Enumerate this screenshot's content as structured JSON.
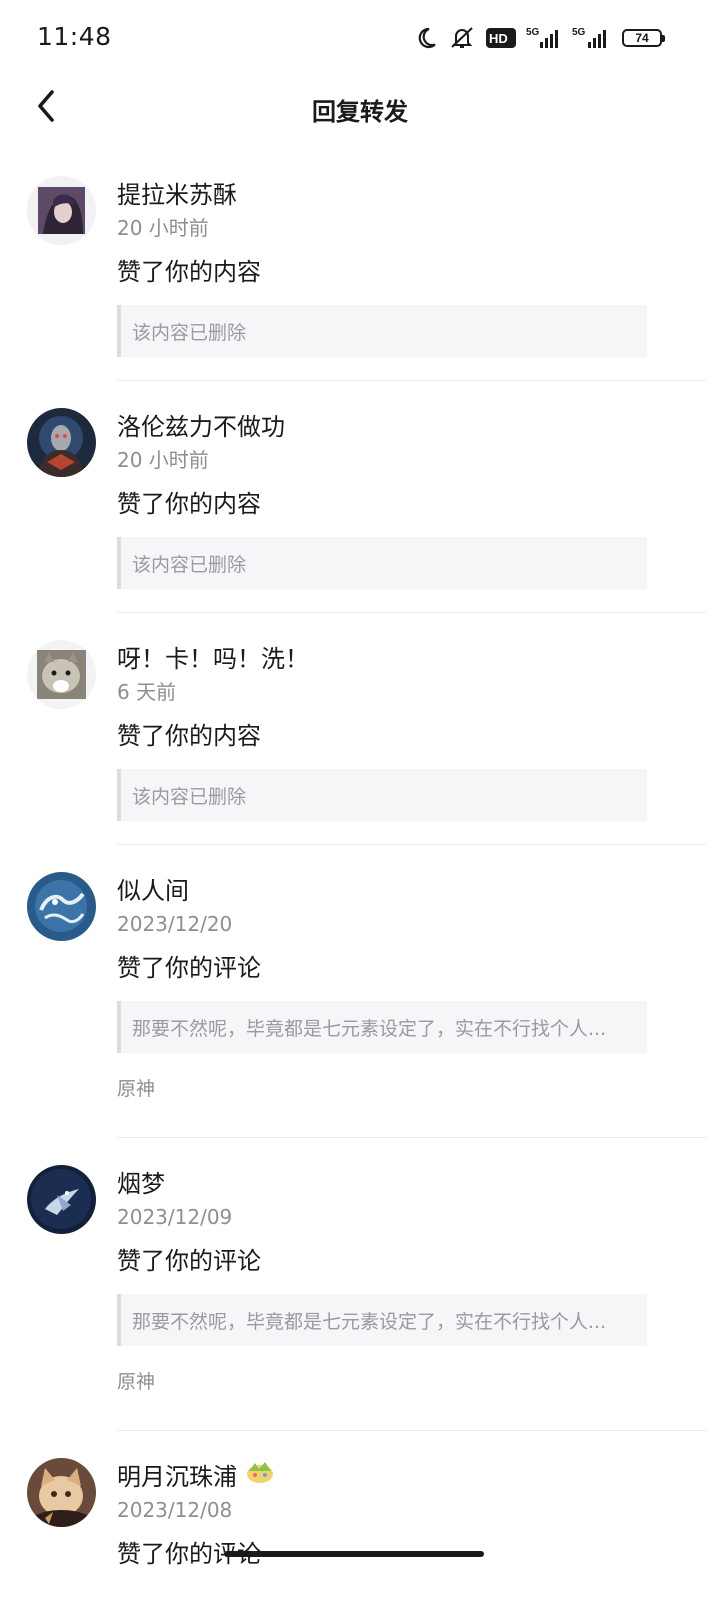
{
  "status_bar": {
    "time": "11:48",
    "icons": [
      "moon-icon",
      "mute-icon",
      "hd-icon",
      "signal-5g-icon",
      "signal-5g-icon"
    ],
    "battery": "74",
    "hd_label": "HD",
    "net_label": "5G"
  },
  "header": {
    "title": "回复转发",
    "back_icon": "chevron-left-icon"
  },
  "items": [
    {
      "user": "提拉米苏酥",
      "time": "20 小时前",
      "action": "赞了你的内容",
      "quote": "该内容已删除",
      "source": ""
    },
    {
      "user": "洛伦兹力不做功",
      "time": "20 小时前",
      "action": "赞了你的内容",
      "quote": "该内容已删除",
      "source": ""
    },
    {
      "user": "呀！卡！吗！洗！",
      "time": "6 天前",
      "action": "赞了你的内容",
      "quote": "该内容已删除",
      "source": ""
    },
    {
      "user": "似人间",
      "time": "2023/12/20",
      "action": "赞了你的评论",
      "quote": "那要不然呢，毕竟都是七元素设定了，实在不行找个人...",
      "source": "原神"
    },
    {
      "user": "烟梦",
      "time": "2023/12/09",
      "action": "赞了你的评论",
      "quote": "那要不然呢，毕竟都是七元素设定了，实在不行找个人...",
      "source": "原神"
    },
    {
      "user": "明月沉珠浦",
      "time": "2023/12/08",
      "action": "赞了你的评论",
      "quote": "",
      "source": ""
    }
  ]
}
